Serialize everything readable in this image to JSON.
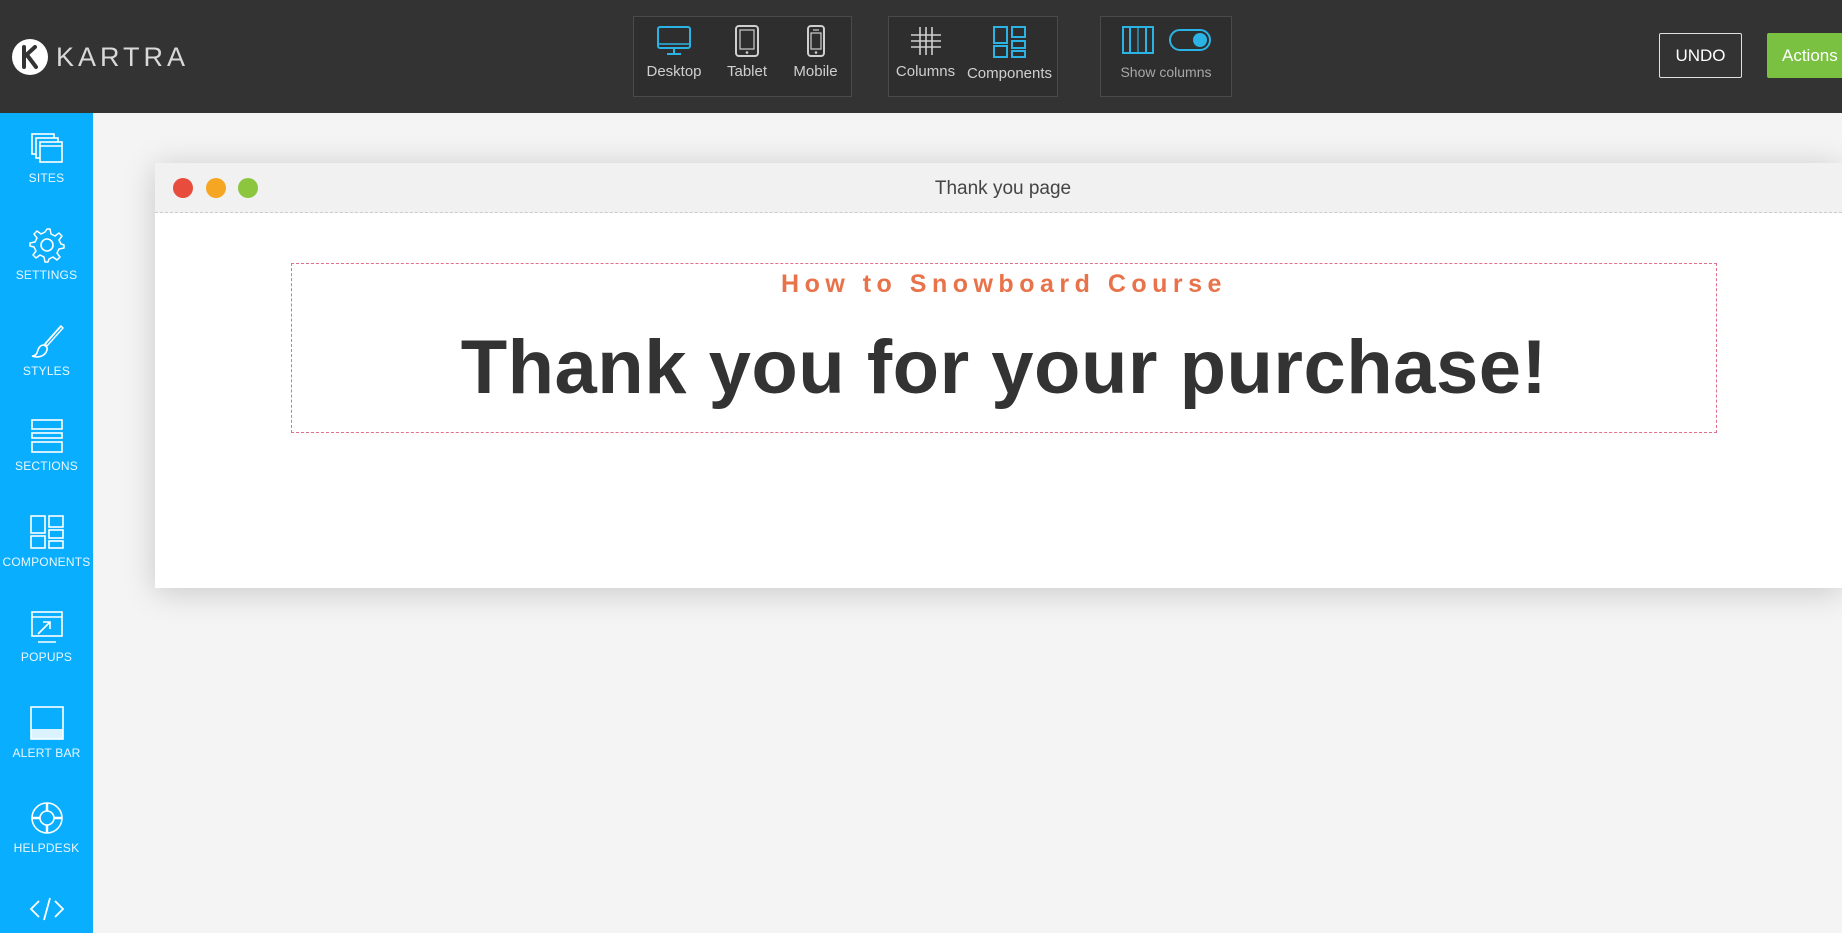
{
  "app": {
    "brand_name": "KARTRA"
  },
  "toolbar": {
    "view_group": [
      {
        "label": "Desktop",
        "icon": "desktop-icon"
      },
      {
        "label": "Tablet",
        "icon": "tablet-icon"
      },
      {
        "label": "Mobile",
        "icon": "mobile-icon"
      }
    ],
    "layout_group": [
      {
        "label": "Columns",
        "icon": "columns-grid-icon"
      },
      {
        "label": "Components",
        "icon": "components-icon"
      }
    ],
    "show_columns": {
      "label": "Show columns",
      "toggle_on": true,
      "icon": "show-columns-icon"
    },
    "undo_label": "UNDO",
    "actions_label": "Actions"
  },
  "sidebar": {
    "items": [
      {
        "label": "SITES",
        "icon": "sites-icon"
      },
      {
        "label": "SETTINGS",
        "icon": "gear-icon"
      },
      {
        "label": "STYLES",
        "icon": "brush-icon"
      },
      {
        "label": "SECTIONS",
        "icon": "sections-icon"
      },
      {
        "label": "COMPONENTS",
        "icon": "components-icon"
      },
      {
        "label": "POPUPS",
        "icon": "popup-icon"
      },
      {
        "label": "ALERT BAR",
        "icon": "alert-bar-icon"
      },
      {
        "label": "HELPDESK",
        "icon": "lifebuoy-icon"
      },
      {
        "label": "",
        "icon": "code-icon"
      }
    ]
  },
  "preview": {
    "window_title": "Thank you page",
    "subtitle": "How to Snowboard Course",
    "headline": "Thank you for your purchase!"
  },
  "colors": {
    "topbar": "#333333",
    "sidebar": "#0aaeff",
    "accent_blue": "#1ba7e0",
    "actions_green": "#7ac142",
    "subtitle_orange": "#e8734a",
    "headline": "#333333"
  }
}
